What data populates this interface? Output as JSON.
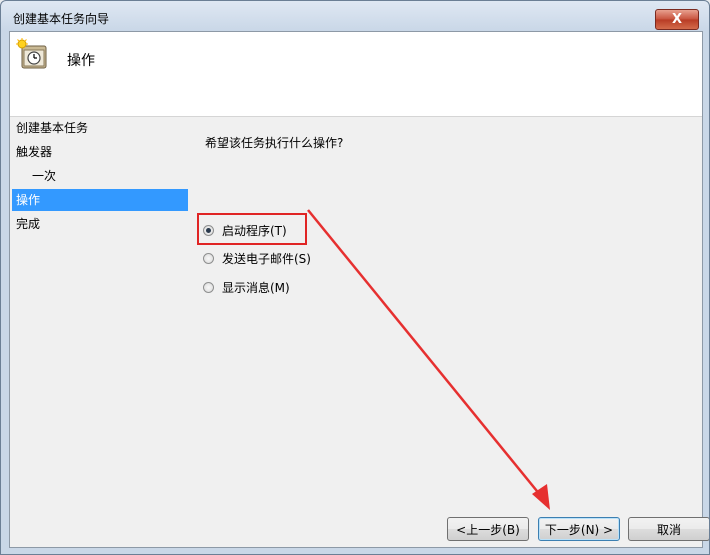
{
  "window": {
    "title": "创建基本任务向导",
    "close_label": "X"
  },
  "header": {
    "icon": "task-clock-icon",
    "title": "操作"
  },
  "nav": {
    "items": [
      {
        "label": "创建基本任务",
        "sub": false,
        "selected": false
      },
      {
        "label": "触发器",
        "sub": false,
        "selected": false
      },
      {
        "label": "一次",
        "sub": true,
        "selected": false
      },
      {
        "label": "操作",
        "sub": false,
        "selected": true
      },
      {
        "label": "完成",
        "sub": false,
        "selected": false
      }
    ]
  },
  "content": {
    "question": "希望该任务执行什么操作?",
    "options": [
      {
        "label": "启动程序(T)",
        "checked": true
      },
      {
        "label": "发送电子邮件(S)",
        "checked": false
      },
      {
        "label": "显示消息(M)",
        "checked": false
      }
    ]
  },
  "buttons": {
    "back": "<上一步(B)",
    "next": "下一步(N) >",
    "cancel": "取消"
  },
  "annotation": {
    "color": "#e02424"
  }
}
